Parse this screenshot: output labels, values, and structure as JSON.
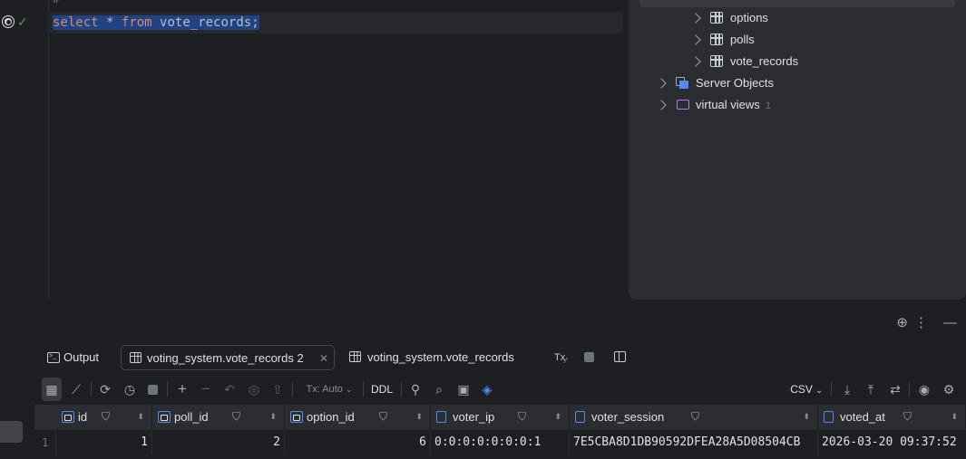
{
  "editor": {
    "previous_line": "#",
    "sql": {
      "kw_select": "select",
      "star": "*",
      "kw_from": "from",
      "table": "vote_records",
      "semicolon": ";"
    }
  },
  "tree": {
    "items": [
      {
        "label": "options",
        "kind": "table"
      },
      {
        "label": "polls",
        "kind": "table"
      },
      {
        "label": "vote_records",
        "kind": "table"
      }
    ],
    "server_objects": {
      "label": "Server Objects"
    },
    "virtual_views": {
      "label": "virtual views",
      "count": "1"
    }
  },
  "panel": {
    "tabs": [
      {
        "label": "Output",
        "icon": "terminal-icon"
      },
      {
        "label": "voting_system.vote_records 2",
        "icon": "table-icon",
        "active": true
      },
      {
        "label": "voting_system.vote_records",
        "icon": "table-icon"
      }
    ],
    "tx_short": "Tx",
    "toolbar": {
      "tx_mode": "Tx: Auto",
      "ddl": "DDL",
      "export_format": "CSV"
    }
  },
  "grid": {
    "columns": [
      {
        "name": "id",
        "kind": "key"
      },
      {
        "name": "poll_id",
        "kind": "key"
      },
      {
        "name": "option_id",
        "kind": "key"
      },
      {
        "name": "voter_ip",
        "kind": "column"
      },
      {
        "name": "voter_session",
        "kind": "column"
      },
      {
        "name": "voted_at",
        "kind": "column"
      }
    ],
    "rows": [
      {
        "num": "1",
        "id": "1",
        "poll_id": "2",
        "option_id": "6",
        "voter_ip": "0:0:0:0:0:0:0:1",
        "voter_session": "7E5CBA8D1DB90592DFEA28A5D08504CB",
        "voted_at": "2026-03-20 09:37:52"
      }
    ]
  },
  "colors": {
    "accent": "#548af7",
    "selection": "#214283",
    "keyword": "#cf8e6d",
    "success": "#57965c"
  }
}
